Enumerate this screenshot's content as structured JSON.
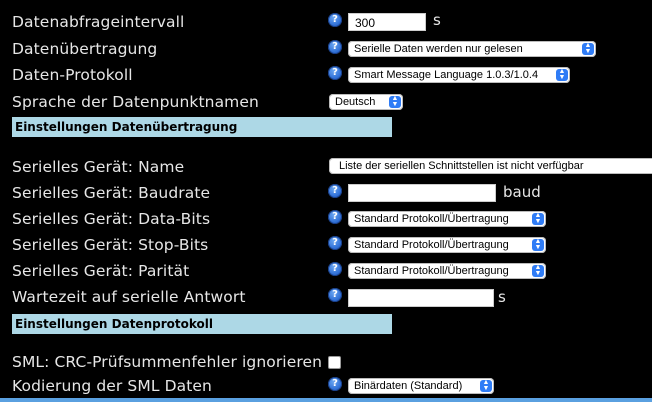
{
  "rows": [
    {
      "label": "Datenabfrageintervall",
      "input_value": "300",
      "unit": "s"
    },
    {
      "label": "Datenübertragung",
      "select": "Serielle Daten werden nur gelesen"
    },
    {
      "label": "Daten-Protokoll",
      "select": "Smart Message Language 1.0.3/1.0.4"
    },
    {
      "label": "Sprache der Datenpunktnamen",
      "select": "Deutsch"
    }
  ],
  "section1": "Einstellungen Datenübertragung",
  "serial": [
    {
      "label": "Serielles Gerät: Name",
      "select": "Liste der seriellen Schnittstellen ist nicht verfügbar"
    },
    {
      "label": "Serielles Gerät: Baudrate",
      "input_value": "",
      "unit": "baud"
    },
    {
      "label": "Serielles Gerät: Data-Bits",
      "select": "Standard Protokoll/Übertragung"
    },
    {
      "label": "Serielles Gerät: Stop-Bits",
      "select": "Standard Protokoll/Übertragung"
    },
    {
      "label": "Serielles Gerät: Parität",
      "select": "Standard Protokoll/Übertragung"
    },
    {
      "label": "Wartezeit auf serielle Antwort",
      "input_value": "",
      "unit": "s"
    }
  ],
  "section2": "Einstellungen Datenprotokoll",
  "sml": [
    {
      "label": "SML: CRC-Prüfsummenfehler ignorieren",
      "checked": false
    },
    {
      "label": "Kodierung der SML Daten",
      "select": "Binärdaten (Standard)"
    }
  ],
  "help_glyph": "?",
  "icon_help": "help-icon",
  "icon_chevron": "chevron-updown-icon"
}
